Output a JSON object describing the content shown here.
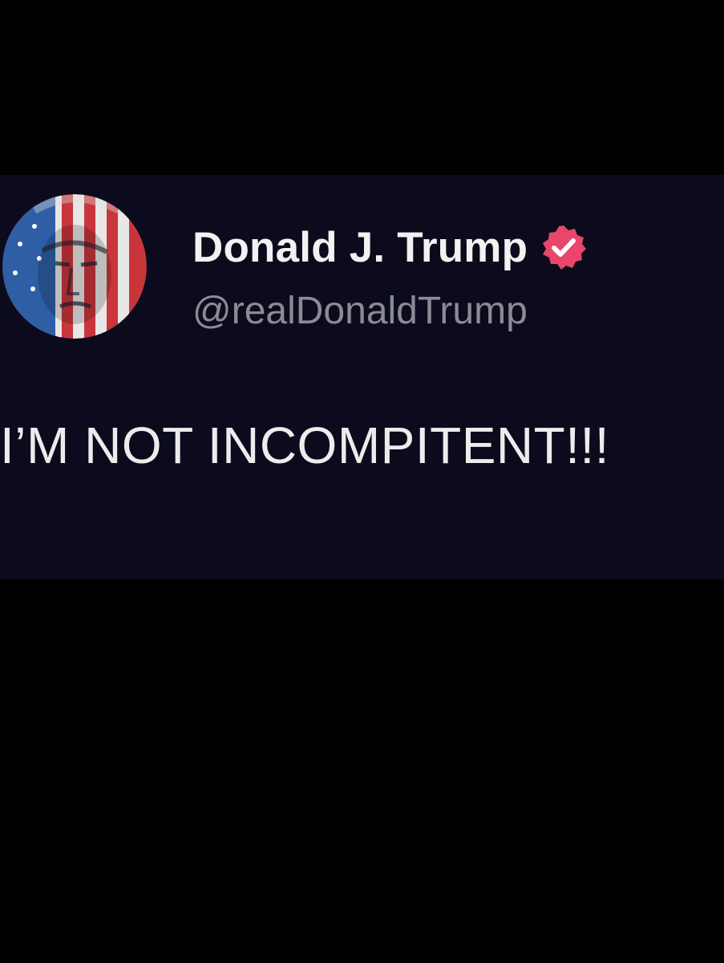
{
  "tweet": {
    "display_name": "Donald J. Trump",
    "handle": "@realDonaldTrump",
    "verified": true,
    "verified_icon": "verified-badge-icon",
    "avatar_icon": "flag-portrait-avatar",
    "text": "I’M NOT INCOMPITENT!!!"
  },
  "colors": {
    "background": "#000000",
    "card_background": "#0b0b1d",
    "name_text": "#f2f2f2",
    "handle_text": "#8b8b95",
    "badge": "#e8466b"
  }
}
